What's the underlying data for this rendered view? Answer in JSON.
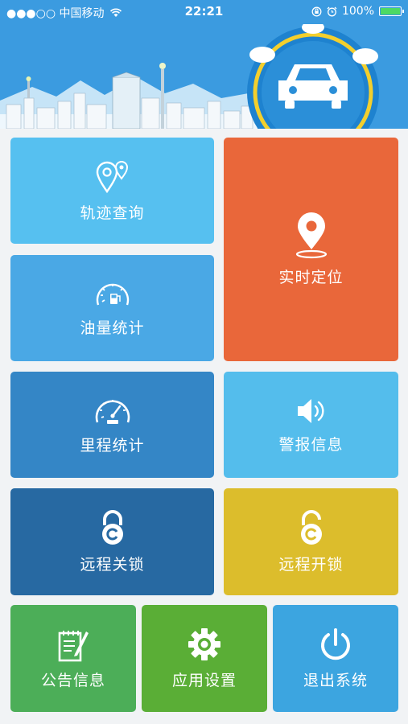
{
  "status_bar": {
    "carrier": "●●●○○ 中国移动",
    "time": "22:21",
    "battery": "100%"
  },
  "tiles": {
    "track": "轨迹查询",
    "locate": "实时定位",
    "fuel": "油量统计",
    "mileage": "里程统计",
    "alarm": "警报信息",
    "remote_lock": "远程关锁",
    "remote_unlock": "远程开锁",
    "notice": "公告信息",
    "settings": "应用设置",
    "logout": "退出系统"
  },
  "colors": {
    "header": "#3b9be0",
    "track": "#56c0f0",
    "locate": "#e9673a",
    "fuel": "#4aa8e5",
    "mileage": "#3486c6",
    "alarm": "#54bdec",
    "remote_lock": "#2769a2",
    "remote_unlock": "#dcbd2c",
    "notice": "#4cae58",
    "settings": "#5aae36",
    "logout": "#3ca5e0"
  }
}
